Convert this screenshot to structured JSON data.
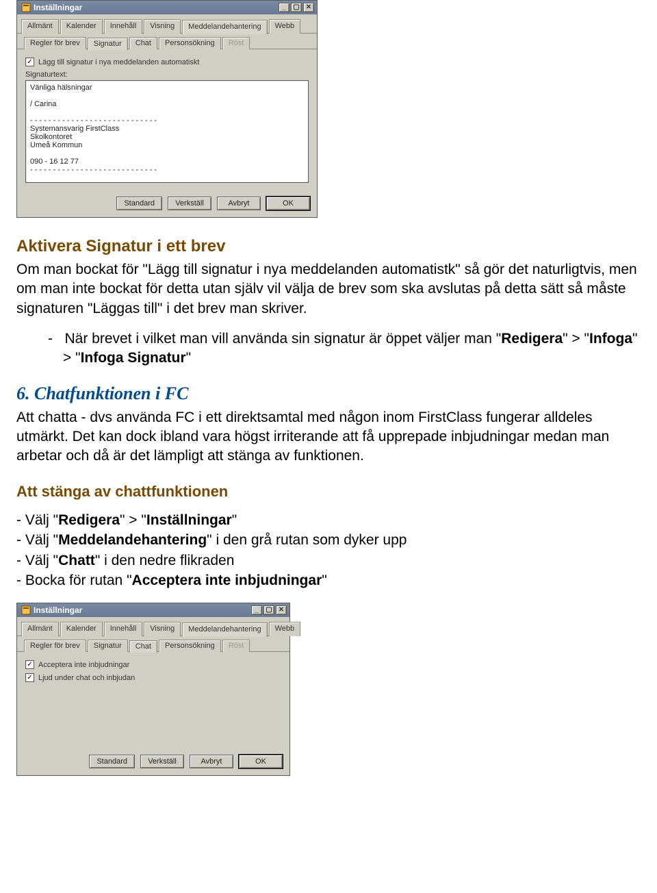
{
  "win1": {
    "title": "Inställningar",
    "ctrl": {
      "min": "_",
      "max": "▢",
      "close": "✕"
    },
    "tabs": [
      "Allmänt",
      "Kalender",
      "Innehåll",
      "Visning",
      "Meddelandehantering",
      "Webb"
    ],
    "activeTab": 4,
    "subtabs": [
      "Regler för brev",
      "Signatur",
      "Chat",
      "Personsökning",
      "Röst"
    ],
    "activeSubtab": 1,
    "disabledSubtabs": [
      4
    ],
    "checkbox_label": "Lägg till signatur i nya meddelanden automatiskt",
    "checkbox_checked": true,
    "sig_label": "Signaturtext:",
    "sig_text": "Vänliga hälsningar\n\n/ Carina\n\n- - - - - - - - - - - - - - - - - - - - - - - - - - - -\nSystemansvarig FirstClass\nSkolkontoret\nUmeå Kommun\n\n090 - 16 12 77\n- - - - - - - - - - - - - - - - - - - - - - - - - - - -",
    "buttons": {
      "standard": "Standard",
      "apply": "Verkställ",
      "cancel": "Avbryt",
      "ok": "OK"
    }
  },
  "doc": {
    "h1": "Aktivera Signatur i ett brev",
    "p1a": "Om man bockat för \"Lägg till signatur i nya meddelanden automatistk\" så gör det naturligtvis, men om man inte bockat för detta utan själv vil välja de brev som ska avslutas på detta sätt så måste signaturen \"Läggas till\" i det brev man skriver.",
    "li1_pre": "När brevet i vilket man vill använda sin signatur är öppet väljer man \"",
    "li1_b1": "Redigera",
    "li1_mid1": "\" > \"",
    "li1_b2": "Infoga",
    "li1_mid2": "\" > \"",
    "li1_b3": "Infoga Signatur",
    "li1_end": "\"",
    "h_section": "6. Chatfunktionen i FC",
    "p2": "Att chatta - dvs använda FC i ett direktsamtal med någon inom FirstClass fungerar alldeles utmärkt. Det kan dock ibland vara högst irriterande att få upprepade inbjudningar medan man arbetar och då är det lämpligt att stänga av funktionen.",
    "h2b": "Att stänga av chattfunktionen",
    "s1_pre": "- Välj \"",
    "s1_b1": "Redigera",
    "s1_mid": "\" > \"",
    "s1_b2": "Inställningar",
    "s1_end": "\"",
    "s2_pre": "- Välj \"",
    "s2_b": "Meddelandehantering",
    "s2_end": "\"  i den grå rutan som dyker upp",
    "s3_pre": "- Välj \"",
    "s3_b": "Chatt",
    "s3_end": "\"  i den nedre flikraden",
    "s4_pre": "- Bocka för rutan \"",
    "s4_b": "Acceptera inte inbjudningar",
    "s4_end": "\""
  },
  "win2": {
    "title": "Inställningar",
    "ctrl": {
      "min": "_",
      "max": "▢",
      "close": "✕"
    },
    "tabs": [
      "Allmänt",
      "Kalender",
      "Innehåll",
      "Visning",
      "Meddelandehantering",
      "Webb"
    ],
    "activeTab": 4,
    "subtabs": [
      "Regler för brev",
      "Signatur",
      "Chat",
      "Personsökning",
      "Röst"
    ],
    "activeSubtab": 2,
    "disabledSubtabs": [
      4
    ],
    "check1_label": "Acceptera inte inbjudningar",
    "check1_checked": true,
    "check2_label": "Ljud under chat och inbjudan",
    "check2_checked": true,
    "buttons": {
      "standard": "Standard",
      "apply": "Verkställ",
      "cancel": "Avbryt",
      "ok": "OK"
    }
  }
}
